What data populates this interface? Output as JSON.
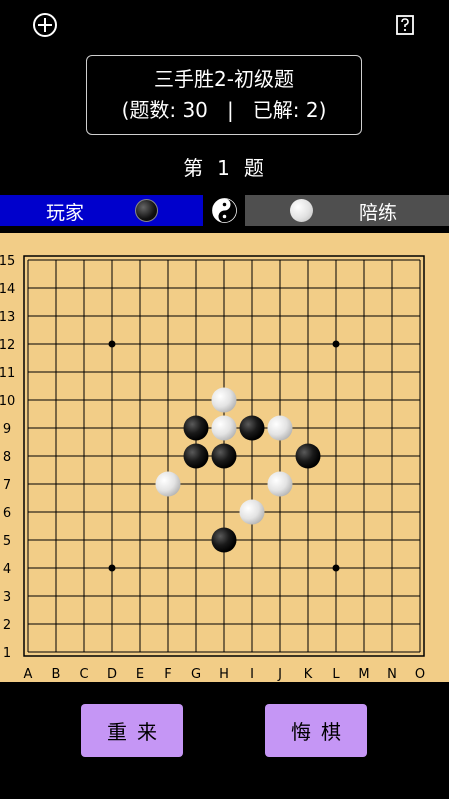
{
  "header": {
    "add_icon": "plus-circle-icon",
    "help_icon": "question-box-icon"
  },
  "puzzle": {
    "title": "三手胜2-初级题",
    "stats": "(题数: 30   |   已解: 2)"
  },
  "question": {
    "prefix": "第",
    "number": "1",
    "suffix": "题"
  },
  "players": {
    "player_label": "玩家",
    "trainer_label": "陪练",
    "player_stone": "black",
    "trainer_stone": "white",
    "middle_icon": "yin-yang-icon"
  },
  "board": {
    "size": 15,
    "columns": [
      "A",
      "B",
      "C",
      "D",
      "E",
      "F",
      "G",
      "H",
      "I",
      "J",
      "K",
      "L",
      "M",
      "N",
      "O"
    ],
    "rows": [
      "15",
      "14",
      "13",
      "12",
      "11",
      "10",
      "9",
      "8",
      "7",
      "6",
      "5",
      "4",
      "3",
      "2",
      "1"
    ],
    "star_points": [
      "D12",
      "L12",
      "D4",
      "L4"
    ],
    "stones": [
      {
        "pos": "H10",
        "color": "white"
      },
      {
        "pos": "G9",
        "color": "black"
      },
      {
        "pos": "H9",
        "color": "white"
      },
      {
        "pos": "I9",
        "color": "black"
      },
      {
        "pos": "J9",
        "color": "white"
      },
      {
        "pos": "G8",
        "color": "black"
      },
      {
        "pos": "H8",
        "color": "black"
      },
      {
        "pos": "K8",
        "color": "black"
      },
      {
        "pos": "F7",
        "color": "white"
      },
      {
        "pos": "J7",
        "color": "white"
      },
      {
        "pos": "I6",
        "color": "white"
      },
      {
        "pos": "H5",
        "color": "black"
      }
    ]
  },
  "buttons": {
    "reset_label": "重来",
    "undo_label": "悔棋"
  },
  "colors": {
    "board": "#f2cd87",
    "player_bar": "#0000cc",
    "trainer_bar": "#4f4f4f",
    "button": "#c596f5"
  }
}
